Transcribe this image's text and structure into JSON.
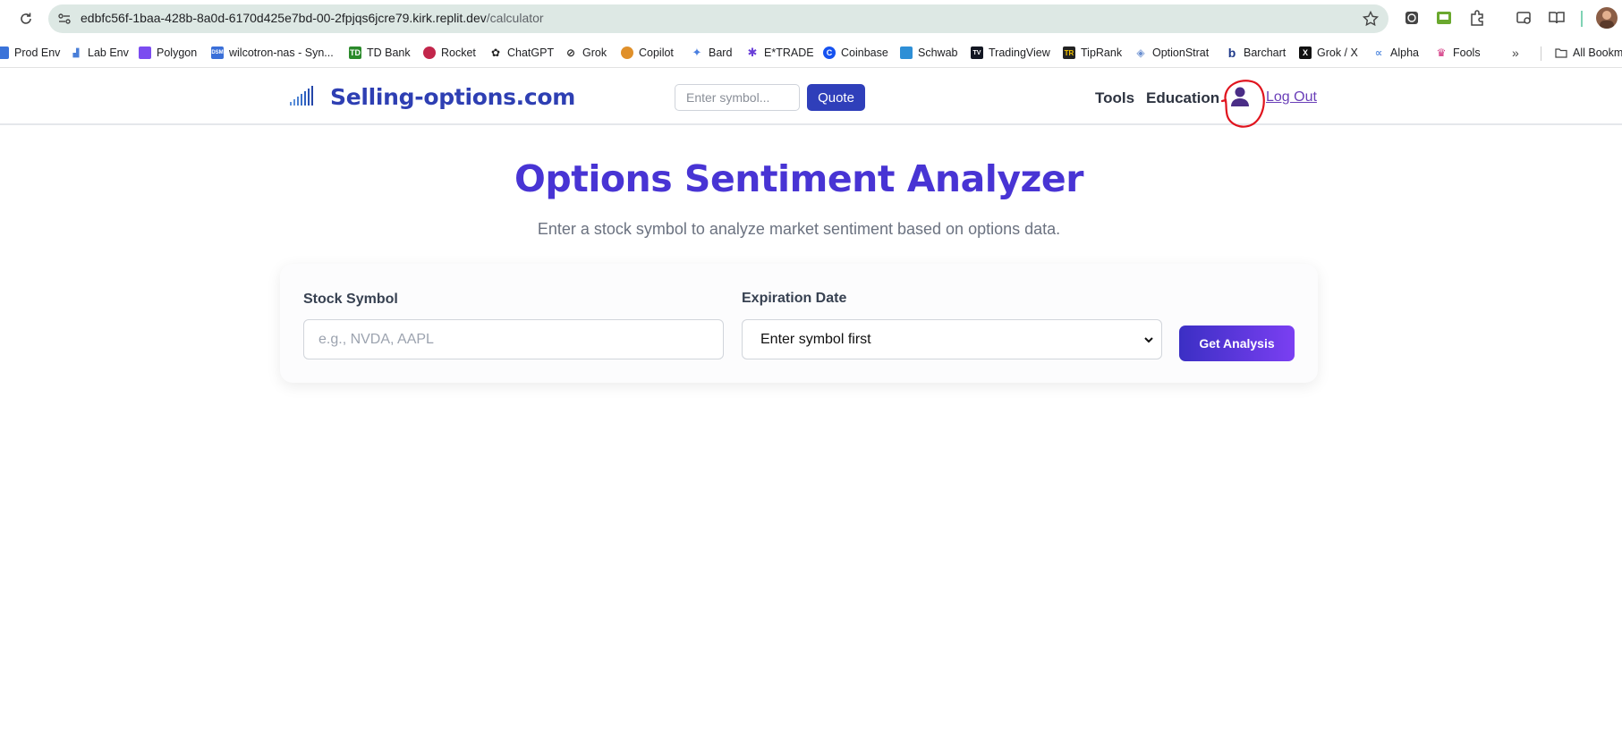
{
  "browser": {
    "url_host": "edbfc56f-1baa-428b-8a0d-6170d425e7bd-00-2fpjqs6jcre79.kirk.replit.dev",
    "url_path": "/calculator",
    "icons": [
      "reload-icon",
      "site-info-icon",
      "star-icon",
      "extension-icons",
      "profile-avatar"
    ]
  },
  "bookmarks": {
    "items": [
      {
        "label": "Prod Env",
        "color": "#3b73d9"
      },
      {
        "label": "Lab Env",
        "color": "#4a7fd8"
      },
      {
        "label": "Polygon",
        "color": "#7b4cf0"
      },
      {
        "label": "wilcotron-nas - Syn...",
        "color": "#3a6fd8"
      },
      {
        "label": "TD Bank",
        "color": "#2b8a2b"
      },
      {
        "label": "Rocket",
        "color": "#c2264b"
      },
      {
        "label": "ChatGPT",
        "color": "#222222"
      },
      {
        "label": "Grok",
        "color": "#222222"
      },
      {
        "label": "Copilot",
        "color": "#e0902a"
      },
      {
        "label": "Bard",
        "color": "#4a7fe0"
      },
      {
        "label": "E*TRADE",
        "color": "#6a3fd8"
      },
      {
        "label": "Coinbase",
        "color": "#1652f0"
      },
      {
        "label": "Schwab",
        "color": "#2e8fd6"
      },
      {
        "label": "TradingView",
        "color": "#131722"
      },
      {
        "label": "TipRank",
        "color": "#222222"
      },
      {
        "label": "OptionStrat",
        "color": "#6a8fd0"
      },
      {
        "label": "Barchart",
        "color": "#1f3a8a"
      },
      {
        "label": "Grok / X",
        "color": "#111111"
      },
      {
        "label": "Alpha",
        "color": "#5a8fe0"
      },
      {
        "label": "Fools",
        "color": "#d02a7a"
      }
    ],
    "more": "»",
    "all_bookmarks": "All Bookm"
  },
  "header": {
    "brand": "Selling-options.com",
    "search_placeholder": "Enter symbol...",
    "quote_label": "Quote",
    "nav": {
      "tools": "Tools",
      "education": "Education"
    },
    "logout": "Log Out",
    "accent": "#2f3fba"
  },
  "main": {
    "title": "Options Sentiment Analyzer",
    "subtitle": "Enter a stock symbol to analyze market sentiment based on options data.",
    "form": {
      "symbol_label": "Stock Symbol",
      "symbol_placeholder": "e.g., NVDA, AAPL",
      "symbol_value": "",
      "expiration_label": "Expiration Date",
      "expiration_selected": "Enter symbol first",
      "submit_label": "Get Analysis"
    }
  }
}
